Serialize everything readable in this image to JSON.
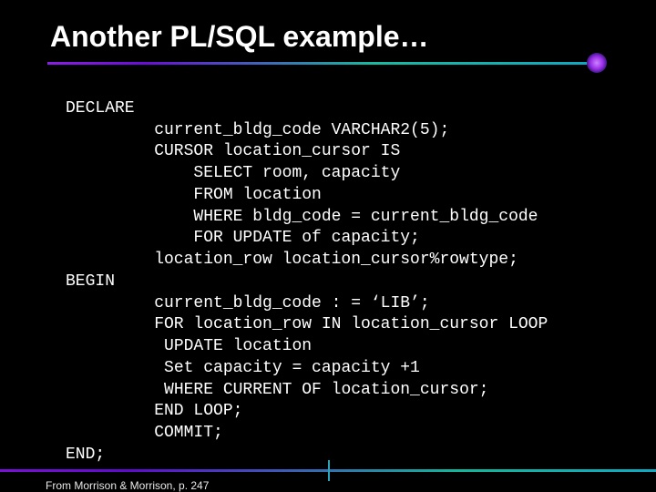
{
  "title": "Another PL/SQL example…",
  "code": {
    "l00": "DECLARE",
    "l01": "current_bldg_code VARCHAR2(5);",
    "l02": "CURSOR location_cursor IS",
    "l03": "SELECT room, capacity",
    "l04": "FROM location",
    "l05": "WHERE bldg_code = current_bldg_code",
    "l06": "FOR UPDATE of capacity;",
    "l07": "location_row location_cursor%rowtype;",
    "l08": "BEGIN",
    "l09": "current_bldg_code : = ‘LIB’;",
    "l10": "FOR location_row IN location_cursor LOOP",
    "l11": "UPDATE location",
    "l12": "Set capacity = capacity +1",
    "l13": "WHERE CURRENT OF location_cursor;",
    "l14": "END LOOP;",
    "l15": "COMMIT;",
    "l16": "END;"
  },
  "footer": "From Morrison & Morrison, p. 247"
}
